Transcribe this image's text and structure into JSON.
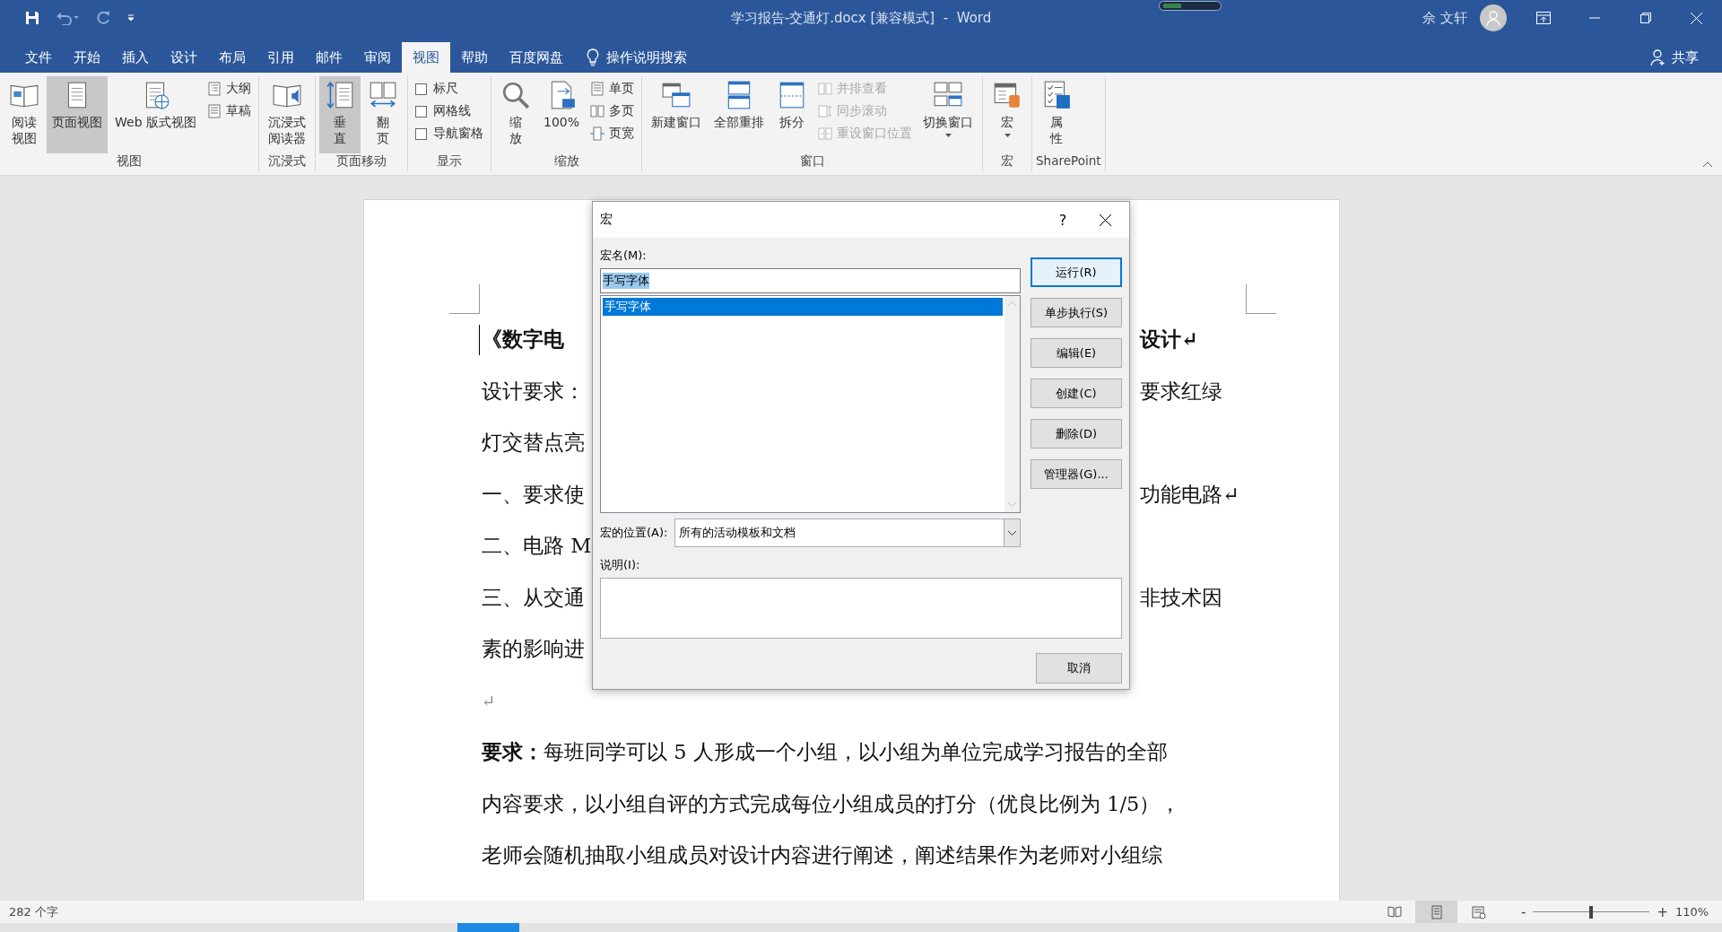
{
  "title_bar": {
    "title": "学习报告-交通灯.docx [兼容模式]  -  Word",
    "user": "佘 文轩"
  },
  "tabs": [
    {
      "label": "文件",
      "selected": false
    },
    {
      "label": "开始",
      "selected": false
    },
    {
      "label": "插入",
      "selected": false
    },
    {
      "label": "设计",
      "selected": false
    },
    {
      "label": "布局",
      "selected": false
    },
    {
      "label": "引用",
      "selected": false
    },
    {
      "label": "邮件",
      "selected": false
    },
    {
      "label": "审阅",
      "selected": false
    },
    {
      "label": "视图",
      "selected": true
    },
    {
      "label": "帮助",
      "selected": false
    },
    {
      "label": "百度网盘",
      "selected": false
    }
  ],
  "tell_me": "操作说明搜索",
  "share": "共享",
  "ribbon_groups": [
    {
      "label": "视图",
      "items": [
        {
          "kind": "large",
          "lines": [
            "阅读",
            "视图"
          ],
          "selected": false,
          "dropdown": false
        },
        {
          "kind": "large",
          "lines": [
            "页面视图"
          ],
          "selected": true,
          "dropdown": false
        },
        {
          "kind": "large",
          "lines": [
            "Web 版式视图"
          ],
          "selected": false,
          "dropdown": false
        },
        {
          "kind": "small",
          "label": "大纲",
          "disabled": false
        },
        {
          "kind": "small",
          "label": "草稿",
          "disabled": false
        }
      ]
    },
    {
      "label": "沉浸式",
      "items": [
        {
          "kind": "large",
          "lines": [
            "沉浸式",
            "阅读器"
          ],
          "selected": false,
          "dropdown": false
        }
      ]
    },
    {
      "label": "页面移动",
      "items": [
        {
          "kind": "large",
          "lines": [
            "垂",
            "直"
          ],
          "selected": true,
          "dropdown": false
        },
        {
          "kind": "large",
          "lines": [
            "翻",
            "页"
          ],
          "selected": false,
          "dropdown": false
        }
      ]
    },
    {
      "label": "显示",
      "items": [
        {
          "kind": "check",
          "label": "标尺",
          "checked": false
        },
        {
          "kind": "check",
          "label": "网格线",
          "checked": false
        },
        {
          "kind": "check",
          "label": "导航窗格",
          "checked": false
        }
      ]
    },
    {
      "label": "缩放",
      "items": [
        {
          "kind": "large",
          "lines": [
            "缩",
            "放"
          ],
          "selected": false,
          "dropdown": false
        },
        {
          "kind": "large",
          "lines": [
            "100%"
          ],
          "selected": false,
          "dropdown": false
        },
        {
          "kind": "small",
          "label": "单页",
          "disabled": false
        },
        {
          "kind": "small",
          "label": "多页",
          "disabled": false
        },
        {
          "kind": "small",
          "label": "页宽",
          "disabled": false
        }
      ]
    },
    {
      "label": "窗口",
      "items": [
        {
          "kind": "large",
          "lines": [
            "新建窗口"
          ],
          "selected": false,
          "dropdown": false
        },
        {
          "kind": "large",
          "lines": [
            "全部重排"
          ],
          "selected": false,
          "dropdown": false
        },
        {
          "kind": "large",
          "lines": [
            "拆分"
          ],
          "selected": false,
          "dropdown": false
        },
        {
          "kind": "small",
          "label": "并排查看",
          "disabled": true
        },
        {
          "kind": "small",
          "label": "同步滚动",
          "disabled": true
        },
        {
          "kind": "small",
          "label": "重设窗口位置",
          "disabled": true
        },
        {
          "kind": "large",
          "lines": [
            "切换窗口"
          ],
          "selected": false,
          "dropdown": true
        }
      ]
    },
    {
      "label": "宏",
      "items": [
        {
          "kind": "large",
          "lines": [
            "宏"
          ],
          "selected": false,
          "dropdown": true
        }
      ]
    },
    {
      "label": "SharePoint",
      "items": [
        {
          "kind": "large",
          "lines": [
            "属",
            "性"
          ],
          "selected": false,
          "dropdown": false
        }
      ]
    }
  ],
  "document": {
    "lines": [
      {
        "kind": "heading",
        "left": "《数字电",
        "right": "设计↵"
      },
      {
        "kind": "body",
        "left": "设计要求：",
        "right": "要求红绿"
      },
      {
        "kind": "body",
        "left": "灯交替点亮"
      },
      {
        "kind": "body",
        "left": "一、要求使",
        "right": "功能电路↵"
      },
      {
        "kind": "body",
        "left": "二、电路 M"
      },
      {
        "kind": "body",
        "left": "三、从交通",
        "right": "非技术因"
      },
      {
        "kind": "body",
        "left": "素的影响进"
      },
      {
        "kind": "mark",
        "left": "↵"
      },
      {
        "kind": "wide",
        "left": "**要求：**每班同学可以 5 人形成一个小组，以小组为单位完成学习报告的全部"
      },
      {
        "kind": "wide",
        "left": "内容要求，以小组自评的方式完成每位小组成员的打分（优良比例为 1/5），"
      },
      {
        "kind": "wide",
        "left": "老师会随机抽取小组成员对设计内容进行阐述，阐述结果作为老师对小组综"
      }
    ]
  },
  "dialog": {
    "title": "宏",
    "help": "?",
    "name_label": "宏名(M):",
    "name_field": {
      "value": "手写字体",
      "text_selected": true
    },
    "macros": [
      {
        "name": "手写字体",
        "selected": true
      }
    ],
    "buttons": [
      {
        "label": "运行(R)",
        "default": true
      },
      {
        "label": "单步执行(S)",
        "default": false
      },
      {
        "label": "编辑(E)",
        "default": false
      },
      {
        "label": "创建(C)",
        "default": false
      },
      {
        "label": "删除(D)",
        "default": false
      },
      {
        "label": "管理器(G)...",
        "default": false
      }
    ],
    "location_label": "宏的位置(A):",
    "location": "所有的活动模板和文档",
    "description_label": "说明(I):",
    "cancel": "取消"
  },
  "status_bar": {
    "word_count": "282 个字",
    "views": [
      {
        "selected": false
      },
      {
        "selected": true
      },
      {
        "selected": false
      }
    ],
    "zoom_out": "-",
    "zoom_in": "+",
    "zoom_slider": {
      "level": 0.5
    },
    "zoom": "110%"
  }
}
